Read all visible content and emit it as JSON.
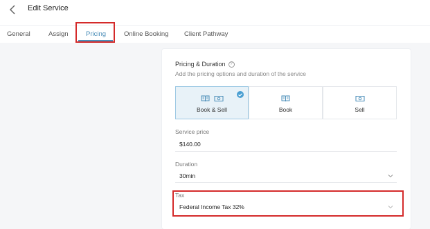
{
  "header": {
    "title": "Edit Service"
  },
  "tabs": [
    {
      "label": "General"
    },
    {
      "label": "Assign"
    },
    {
      "label": "Pricing"
    },
    {
      "label": "Online Booking"
    },
    {
      "label": "Client Pathway"
    }
  ],
  "active_tab": "Pricing",
  "pricing": {
    "title": "Pricing & Duration",
    "subtitle": "Add the pricing options and duration of the service",
    "options": [
      {
        "label": "Book & Sell",
        "selected": true
      },
      {
        "label": "Book",
        "selected": false
      },
      {
        "label": "Sell",
        "selected": false
      }
    ]
  },
  "fields": {
    "price_label": "Service price",
    "price_value": "$140.00",
    "duration_label": "Duration",
    "duration_value": "30min",
    "tax_label": "Tax",
    "tax_value": "Federal Income Tax 32%"
  },
  "colors": {
    "accent": "#4a8db8",
    "highlight": "#d42a2a",
    "selected_bg": "#e8f2f8"
  }
}
